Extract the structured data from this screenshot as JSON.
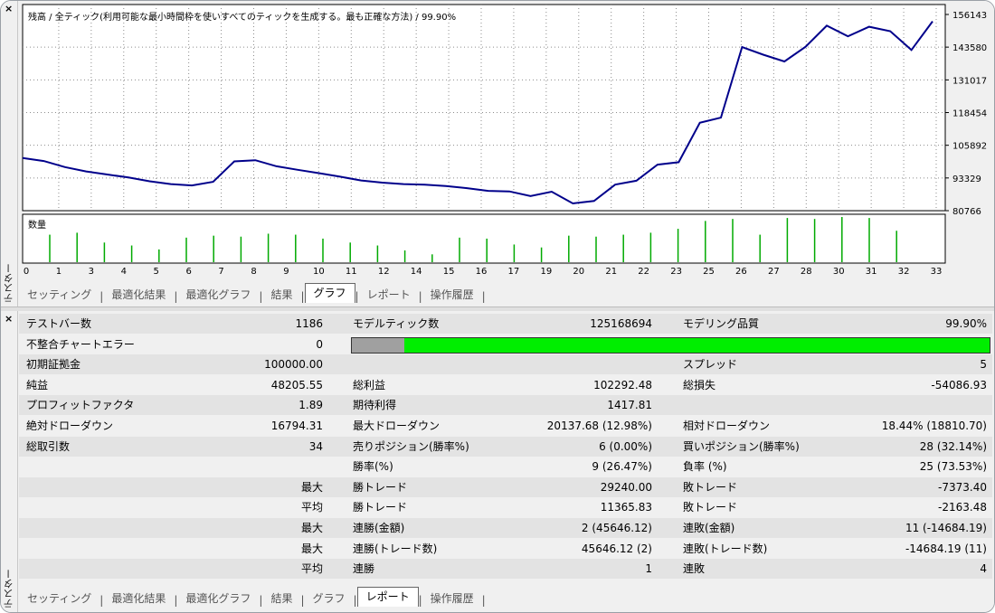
{
  "chart": {
    "title": "残高 / 全ティック(利用可能な最小時間枠を使いすべてのティックを生成する。最も正確な方法) / 99.90%",
    "volume_label": "数量",
    "y_ticks": [
      "156143",
      "143580",
      "131017",
      "118454",
      "105892",
      "93329",
      "80766"
    ],
    "x_ticks": [
      "0",
      "1",
      "3",
      "4",
      "5",
      "6",
      "7",
      "8",
      "9",
      "10",
      "11",
      "12",
      "14",
      "15",
      "16",
      "17",
      "19",
      "20",
      "21",
      "22",
      "23",
      "25",
      "26",
      "27",
      "28",
      "30",
      "31",
      "32",
      "33"
    ],
    "line_color": "#00008b",
    "volume_color": "#00aa00"
  },
  "chart_data": {
    "type": "line",
    "title": "残高 / 全ティック(利用可能な最小時間枠を使いすべてのティックを生成する。最も正確な方法) / 99.90%",
    "xlabel": "",
    "ylabel": "",
    "ylim": [
      80766,
      156143
    ],
    "x": [
      0,
      1,
      2,
      3,
      4,
      5,
      6,
      7,
      8,
      9,
      10,
      11,
      12,
      13,
      14,
      15,
      16,
      17,
      18,
      19,
      20,
      21,
      22,
      23,
      24,
      25,
      26,
      27,
      28,
      29,
      30,
      31,
      32,
      33,
      34
    ],
    "series": [
      {
        "values": [
          100000,
          98900,
          96700,
          95100,
          94000,
          92900,
          91500,
          90500,
          90000,
          91300,
          98800,
          99200,
          97000,
          95700,
          94500,
          93200,
          91800,
          91000,
          90500,
          90300,
          89800,
          89000,
          88000,
          87800,
          86100,
          87700,
          83400,
          84300,
          90300,
          91700,
          97600,
          98500,
          112900,
          114800,
          140600,
          137800,
          135300,
          140700,
          148400,
          144500,
          148000,
          146400,
          139500,
          150000
        ]
      }
    ],
    "volume": {
      "label": "数量",
      "values": [
        28,
        30,
        20,
        17,
        13,
        25,
        27,
        26,
        29,
        28,
        24,
        20,
        17,
        12,
        8,
        25,
        24,
        18,
        15,
        27,
        26,
        28,
        30,
        34,
        42,
        44,
        28,
        45,
        44,
        46,
        45,
        32
      ]
    }
  },
  "tabs_top": [
    "セッティング",
    "最適化結果",
    "最適化グラフ",
    "結果",
    "グラフ",
    "レポート",
    "操作履歴"
  ],
  "tabs_bottom": [
    "セッティング",
    "最適化結果",
    "最適化グラフ",
    "結果",
    "グラフ",
    "レポート",
    "操作履歴"
  ],
  "side_label": "テスター",
  "close_icon": "×",
  "report": {
    "rows": [
      {
        "c1": "テストバー数",
        "v1": "1186",
        "c2": "モデルティック数",
        "v2": "125168694",
        "c3": "モデリング品質",
        "v3": "99.90%"
      },
      {
        "c1": "不整合チャートエラー",
        "v1": "0",
        "c2": "",
        "v2": "",
        "c3": "",
        "v3": ""
      },
      {
        "c1": "初期証拠金",
        "v1": "100000.00",
        "c2": "",
        "v2": "",
        "c3": "スプレッド",
        "v3": "5"
      },
      {
        "c1": "純益",
        "v1": "48205.55",
        "c2": "総利益",
        "v2": "102292.48",
        "c3": "総損失",
        "v3": "-54086.93"
      },
      {
        "c1": "プロフィットファクタ",
        "v1": "1.89",
        "c2": "期待利得",
        "v2": "1417.81",
        "c3": "",
        "v3": ""
      },
      {
        "c1": "絶対ドローダウン",
        "v1": "16794.31",
        "c2": "最大ドローダウン",
        "v2": "20137.68 (12.98%)",
        "c3": "相対ドローダウン",
        "v3": "18.44% (18810.70)"
      },
      {
        "c1": "総取引数",
        "v1": "34",
        "c2": "売りポジション(勝率%)",
        "v2": "6 (0.00%)",
        "c3": "買いポジション(勝率%)",
        "v3": "28 (32.14%)"
      },
      {
        "c1": "",
        "v1": "",
        "c2": "勝率(%)",
        "v2": "9 (26.47%)",
        "c3": "負率 (%)",
        "v3": "25 (73.53%)"
      },
      {
        "c1": "",
        "v1": "最大",
        "c2": "勝トレード",
        "v2": "29240.00",
        "c3": "敗トレード",
        "v3": "-7373.40"
      },
      {
        "c1": "",
        "v1": "平均",
        "c2": "勝トレード",
        "v2": "11365.83",
        "c3": "敗トレード",
        "v3": "-2163.48"
      },
      {
        "c1": "",
        "v1": "最大",
        "c2": "連勝(金額)",
        "v2": "2 (45646.12)",
        "c3": "連敗(金額)",
        "v3": "11 (-14684.19)"
      },
      {
        "c1": "",
        "v1": "最大",
        "c2": "連勝(トレード数)",
        "v2": "45646.12 (2)",
        "c3": "連敗(トレード数)",
        "v3": "-14684.19 (11)"
      },
      {
        "c1": "",
        "v1": "平均",
        "c2": "連勝",
        "v2": "1",
        "c3": "連敗",
        "v3": "4"
      }
    ],
    "modeling_quality_fraction": 0.999,
    "quality_colors": {
      "gray": "#a0a0a0",
      "green": "#00ee00"
    }
  }
}
